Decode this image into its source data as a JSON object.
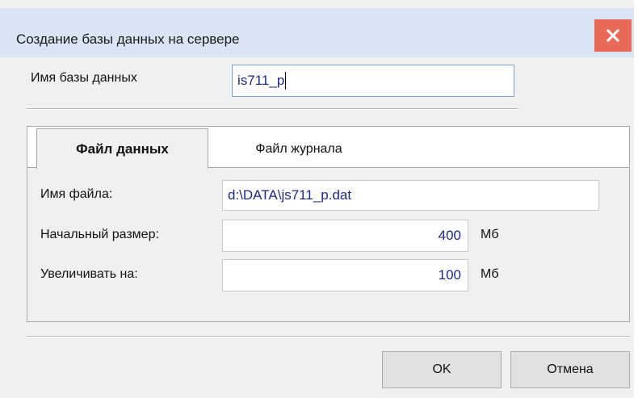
{
  "window": {
    "title": "Создание базы данных на сервере",
    "close_icon": "close-icon"
  },
  "db_name": {
    "label": "Имя базы данных",
    "value": "is711_p"
  },
  "tabs": [
    {
      "label": "Файл данных",
      "active": true
    },
    {
      "label": "Файл журнала",
      "active": false
    }
  ],
  "data_file": {
    "file_label": "Имя файла:",
    "file_value": "d:\\DATA\\js711_p.dat",
    "initial_size_label": "Начальный размер:",
    "initial_size_value": "400",
    "initial_size_unit": "Мб",
    "grow_label": "Увеличивать на:",
    "grow_value": "100",
    "grow_unit": "Мб"
  },
  "buttons": {
    "ok": "OK",
    "cancel": "Отмена"
  },
  "colors": {
    "titlebar": "#dae4f4",
    "close": "#ea6a5a",
    "input_text": "#1b2a8a"
  }
}
